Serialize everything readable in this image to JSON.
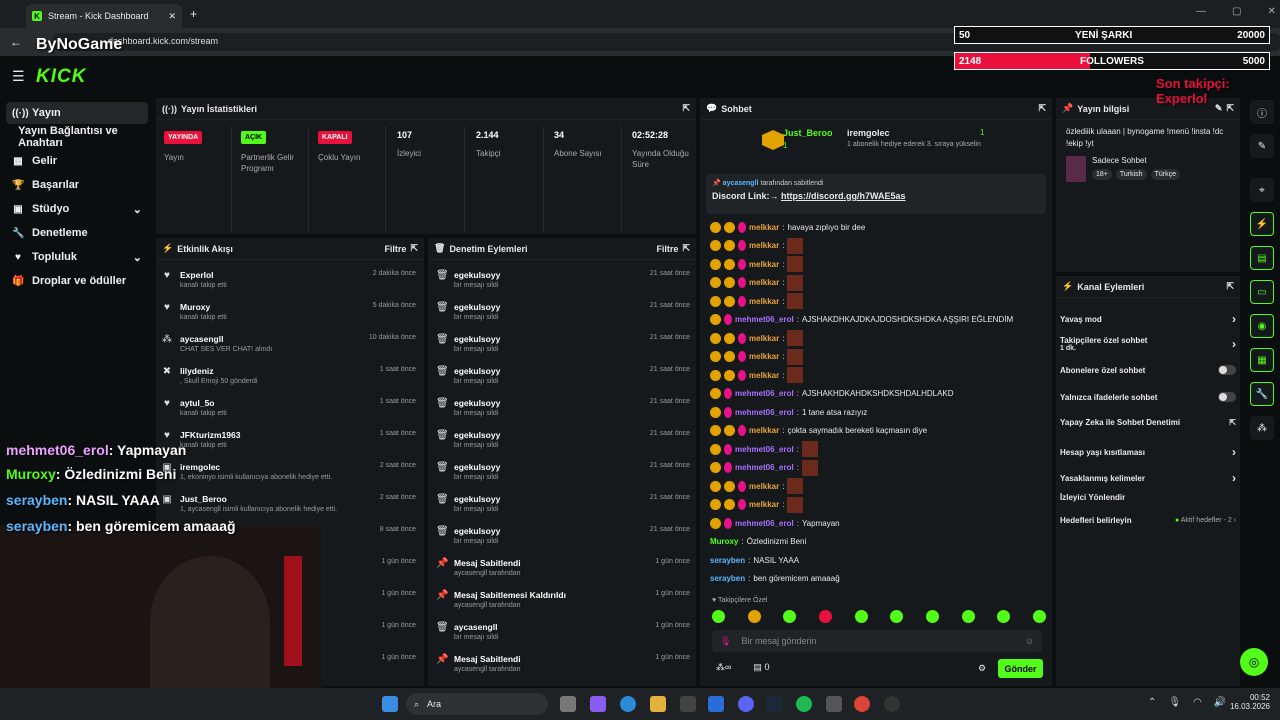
{
  "browser": {
    "tab_title": "Stream - Kick Dashboard",
    "url": "dashboard.kick.com/stream"
  },
  "header": {
    "logo": "KICK"
  },
  "sidebar": {
    "items": [
      {
        "label": "Yayın",
        "icon": "signal-icon"
      },
      {
        "label": "Yayın Bağlantısı ve Anahtarı",
        "icon": ""
      },
      {
        "label": "Gelir",
        "icon": "wallet-icon"
      },
      {
        "label": "Başarılar",
        "icon": "trophy-icon"
      },
      {
        "label": "Stüdyo",
        "icon": "studio-icon"
      },
      {
        "label": "Denetleme",
        "icon": "wrench-icon"
      },
      {
        "label": "Topluluk",
        "icon": "community-icon"
      },
      {
        "label": "Droplar ve ödüller",
        "icon": "gift-icon"
      }
    ]
  },
  "stats": {
    "title": "Yayın İstatistikleri",
    "items": [
      {
        "badge": "YAYINDA",
        "label": "Yayın"
      },
      {
        "badge": "AÇIK",
        "label": "Partnerlik Gelir Programı"
      },
      {
        "badge": "KAPALI",
        "label": "Çoklu Yayın"
      },
      {
        "value": "107",
        "label": "İzleyici"
      },
      {
        "value": "2.144",
        "label": "Takipçi"
      },
      {
        "value": "34",
        "label": "Abone Sayısı"
      },
      {
        "value": "02:52:28",
        "label": "Yayında Olduğu Süre"
      }
    ]
  },
  "activity": {
    "title": "Etkinlik Akışı",
    "filter": "Filtre",
    "rows": [
      {
        "name": "Experlol",
        "sub": "kanalı takip etti",
        "time": "2 dakika önce"
      },
      {
        "name": "Muroxy",
        "sub": "kanalı takip etti",
        "time": "5 dakika önce"
      },
      {
        "name": "aycasengll",
        "sub": "CHAT SES VER CHAT! alındı",
        "time": "10 dakika önce"
      },
      {
        "name": "lilydeniz",
        "sub": ", Skull Emoji 50 gönderdi",
        "time": "1 saat önce"
      },
      {
        "name": "aytul_5o",
        "sub": "kanalı takip etti",
        "time": "1 saat önce"
      },
      {
        "name": "JFKturizm1963",
        "sub": "kanalı takip etti",
        "time": "1 saat önce"
      },
      {
        "name": "iremgolec",
        "sub": "1, ekoninyo isimli kullanıcıya abonelik hediye etti.",
        "time": "2 saat önce"
      },
      {
        "name": "Just_Beroo",
        "sub": "1, aycasengll isimli kullanıcıya abonelik hediye etti.",
        "time": "2 saat önce"
      },
      {
        "name": "",
        "sub": "",
        "time": "8 saat önce"
      },
      {
        "name": "",
        "sub": "",
        "time": "1 gün önce"
      },
      {
        "name": "",
        "sub": "",
        "time": "1 gün önce"
      },
      {
        "name": "",
        "sub": "",
        "time": "1 gün önce"
      },
      {
        "name": "",
        "sub": "",
        "time": "1 gün önce"
      }
    ]
  },
  "moderation": {
    "title": "Denetim Eylemleri",
    "filter": "Filtre",
    "rows": [
      {
        "name": "egekulsoyy",
        "sub": "bir mesajı sildi",
        "time": "21 saat önce"
      },
      {
        "name": "egekulsoyy",
        "sub": "bir mesajı sildi",
        "time": "21 saat önce"
      },
      {
        "name": "egekulsoyy",
        "sub": "bir mesajı sildi",
        "time": "21 saat önce"
      },
      {
        "name": "egekulsoyy",
        "sub": "bir mesajı sildi",
        "time": "21 saat önce"
      },
      {
        "name": "egekulsoyy",
        "sub": "bir mesajı sildi",
        "time": "21 saat önce"
      },
      {
        "name": "egekulsoyy",
        "sub": "bir mesajı sildi",
        "time": "21 saat önce"
      },
      {
        "name": "egekulsoyy",
        "sub": "bir mesajı sildi",
        "time": "21 saat önce"
      },
      {
        "name": "egekulsoyy",
        "sub": "bir mesajı sildi",
        "time": "21 saat önce"
      },
      {
        "name": "egekulsoyy",
        "sub": "bir mesajı sildi",
        "time": "21 saat önce"
      },
      {
        "name": "Mesaj Sabitlendi",
        "sub": "aycasengll tarafından",
        "time": "1 gün önce"
      },
      {
        "name": "Mesaj Sabitlemesi Kaldırıldı",
        "sub": "aycasengll tarafından",
        "time": "1 gün önce"
      },
      {
        "name": "aycasengll",
        "sub": "bir mesajı sildi",
        "time": "1 gün önce"
      },
      {
        "name": "Mesaj Sabitlendi",
        "sub": "aycasengll tarafından",
        "time": "1 gün önce"
      }
    ]
  },
  "chat": {
    "title": "Sohbet",
    "gifter": "Just_Beroo",
    "gifter_count": "1",
    "gift_target": "iremgolec",
    "gift_count": "1",
    "gift_text": "1 abonelik hediye ederek 3. sıraya yükselin",
    "pinned_by": "aycasengll",
    "pinned_suffix": "tarafından sabitlendi",
    "pinned_label": "Discord Link:→",
    "pinned_link": "https://discord.gg/h7WAE5as",
    "messages": [
      {
        "user": "melkkar",
        "color": "#e9a23b",
        "text": "havaya zıplıyo bir dee",
        "emote": false
      },
      {
        "user": "melkkar",
        "color": "#e9a23b",
        "text": "",
        "emote": true
      },
      {
        "user": "melkkar",
        "color": "#e9a23b",
        "text": "",
        "emote": true
      },
      {
        "user": "melkkar",
        "color": "#e9a23b",
        "text": "",
        "emote": true
      },
      {
        "user": "melkkar",
        "color": "#e9a23b",
        "text": "",
        "emote": true
      },
      {
        "user": "mehmet06_erol",
        "color": "#a970ff",
        "text": "AJSHAKDHKAJDKAJDOSHDKSHDKA AŞŞIRI EĞLENDİM",
        "emote": false
      },
      {
        "user": "melkkar",
        "color": "#e9a23b",
        "text": "",
        "emote": true
      },
      {
        "user": "melkkar",
        "color": "#e9a23b",
        "text": "",
        "emote": true
      },
      {
        "user": "melkkar",
        "color": "#e9a23b",
        "text": "",
        "emote": true
      },
      {
        "user": "mehmet06_erol",
        "color": "#a970ff",
        "text": "AJSHAKHDKAHDKSHDKSHDALHDLAKD",
        "emote": false
      },
      {
        "user": "mehmet06_erol",
        "color": "#a970ff",
        "text": "1 tane atsa razıyız",
        "emote": false
      },
      {
        "user": "melkkar",
        "color": "#e9a23b",
        "text": "çokta saymadık bereketi kaçmasın diye",
        "emote": false
      },
      {
        "user": "mehmet06_erol",
        "color": "#a970ff",
        "text": "",
        "emote": true
      },
      {
        "user": "mehmet06_erol",
        "color": "#a970ff",
        "text": "",
        "emote": true
      },
      {
        "user": "melkkar",
        "color": "#e9a23b",
        "text": "",
        "emote": true
      },
      {
        "user": "melkkar",
        "color": "#e9a23b",
        "text": "",
        "emote": true
      },
      {
        "user": "mehmet06_erol",
        "color": "#a970ff",
        "text": "Yapmayan",
        "emote": false
      },
      {
        "user": "Muroxy",
        "color": "#53fc18",
        "text": "Özledinizmi Beni",
        "emote": false
      },
      {
        "user": "serayben",
        "color": "#5bb7ff",
        "text": "NASIL YAAA",
        "emote": false
      },
      {
        "user": "serayben",
        "color": "#5bb7ff",
        "text": "ben göremicem amaaağ",
        "emote": false
      }
    ],
    "emote_section": "Takipçilere Özel",
    "input_placeholder": "Bir mesaj gönderin",
    "points": "0",
    "send": "Gönder"
  },
  "info": {
    "title": "Yayın bilgisi",
    "stream_title": "özlediiik ulaaan | bynogame !menü !insta !dc !ekip !yt",
    "category": "Sadece Sohbet",
    "tags": [
      "18+",
      "Turkish",
      "Türkçe"
    ]
  },
  "channel_actions": {
    "title": "Kanal Eylemleri",
    "items": [
      {
        "label": "Yavaş mod",
        "kind": "arrow",
        "sub": ""
      },
      {
        "label": "Takipçilere özel sohbet",
        "kind": "arrow",
        "sub": "1 dk."
      },
      {
        "label": "Abonelere özel sohbet",
        "kind": "toggle",
        "sub": ""
      },
      {
        "label": "Yalnızca ifadelerle sohbet",
        "kind": "toggle",
        "sub": ""
      },
      {
        "label": "Yapay Zeka ile Sohbet Denetimi",
        "kind": "ext",
        "sub": ""
      },
      {
        "label": "Hesap yaşı kısıtlaması",
        "kind": "arrow",
        "sub": ""
      },
      {
        "label": "Yasaklanmış kelimeler",
        "kind": "arrow",
        "sub": ""
      },
      {
        "label": "İzleyici Yönlendir",
        "kind": "none",
        "sub": ""
      },
      {
        "label": "Hedefleri belirleyin",
        "kind": "goal",
        "sub": "Aktif hedefler - 2"
      }
    ]
  },
  "overlay": {
    "brand": "ByNoGame",
    "box1": {
      "left": "50",
      "mid": "YENİ ŞARKI",
      "right": "20000"
    },
    "box2": {
      "left": "2148",
      "mid": "FOLLOWERS",
      "right": "5000",
      "progress": 0.43
    },
    "last_follower": "Son takipçi: Experlol",
    "chat": [
      {
        "user": "mehmet06_erol",
        "color": "#e9a3ff",
        "text": ": Yapmayan"
      },
      {
        "user": "Muroxy",
        "color": "#53fc18",
        "text": ": Özledinizmi Beni"
      },
      {
        "user": "serayben",
        "color": "#5bb7ff",
        "text": ": NASIL YAAA"
      },
      {
        "user": "serayben",
        "color": "#5bb7ff",
        "text": ": ben göremicem amaaağ"
      }
    ]
  },
  "taskbar": {
    "search": "Ara",
    "time": "00:52",
    "date": "16.03.2026"
  }
}
